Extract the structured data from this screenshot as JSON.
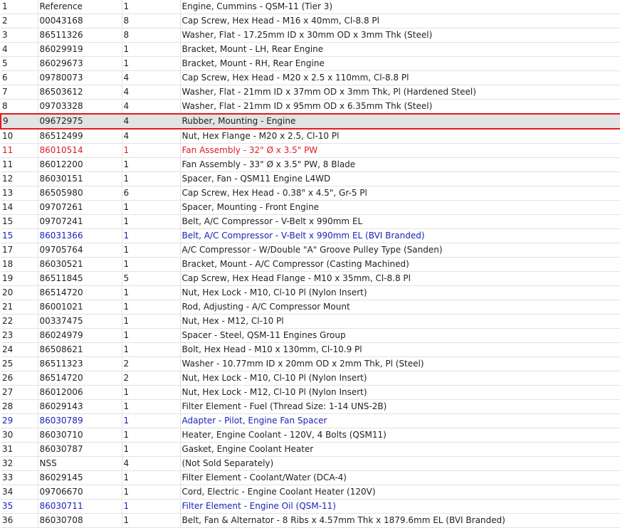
{
  "colors": {
    "selected_border": "#e11b22",
    "selected_bg": "#e3e3e3",
    "red_text": "#e11b22",
    "blue_text": "#1a23b8",
    "grid": "#e2e2e2"
  },
  "parts_table": {
    "rows": [
      {
        "num": "1",
        "part": "Reference",
        "qty": "1",
        "desc": "Engine, Cummins - QSM-11 (Tier 3)",
        "style": ""
      },
      {
        "num": "2",
        "part": "00043168",
        "qty": "8",
        "desc": "Cap Screw, Hex Head - M16 x 40mm, Cl-8.8 Pl",
        "style": ""
      },
      {
        "num": "3",
        "part": "86511326",
        "qty": "8",
        "desc": "Washer, Flat - 17.25mm ID x 30mm OD x 3mm Thk (Steel)",
        "style": ""
      },
      {
        "num": "4",
        "part": "86029919",
        "qty": "1",
        "desc": "Bracket, Mount - LH, Rear Engine",
        "style": ""
      },
      {
        "num": "5",
        "part": "86029673",
        "qty": "1",
        "desc": "Bracket, Mount - RH, Rear Engine",
        "style": ""
      },
      {
        "num": "6",
        "part": "09780073",
        "qty": "4",
        "desc": "Cap Screw, Hex Head - M20 x 2.5 x 110mm, Cl-8.8 Pl",
        "style": ""
      },
      {
        "num": "7",
        "part": "86503612",
        "qty": "4",
        "desc": "Washer, Flat - 21mm ID x 37mm OD x 3mm Thk, Pl (Hardened Steel)",
        "style": ""
      },
      {
        "num": "8",
        "part": "09703328",
        "qty": "4",
        "desc": "Washer, Flat - 21mm ID x 95mm OD x 6.35mm Thk (Steel)",
        "style": ""
      },
      {
        "num": "9",
        "part": "09672975",
        "qty": "4",
        "desc": "Rubber, Mounting - Engine",
        "style": "sel"
      },
      {
        "num": "10",
        "part": "86512499",
        "qty": "4",
        "desc": "Nut, Hex Flange - M20 x 2.5, Cl-10 Pl",
        "style": ""
      },
      {
        "num": "11",
        "part": "86010514",
        "qty": "1",
        "desc": "Fan Assembly - 32\" Ø x 3.5\" PW",
        "style": "red"
      },
      {
        "num": "11",
        "part": "86012200",
        "qty": "1",
        "desc": "Fan Assembly - 33\" Ø x 3.5\" PW, 8 Blade",
        "style": ""
      },
      {
        "num": "12",
        "part": "86030151",
        "qty": "1",
        "desc": "Spacer, Fan - QSM11 Engine L4WD",
        "style": ""
      },
      {
        "num": "13",
        "part": "86505980",
        "qty": "6",
        "desc": "Cap Screw, Hex Head - 0.38\" x 4.5\", Gr-5 Pl",
        "style": ""
      },
      {
        "num": "14",
        "part": "09707261",
        "qty": "1",
        "desc": "Spacer, Mounting - Front Engine",
        "style": ""
      },
      {
        "num": "15",
        "part": "09707241",
        "qty": "1",
        "desc": "Belt, A/C Compressor - V-Belt x 990mm EL",
        "style": ""
      },
      {
        "num": "15",
        "part": "86031366",
        "qty": "1",
        "desc": "Belt, A/C Compressor - V-Belt x 990mm EL (BVI Branded)",
        "style": "blue"
      },
      {
        "num": "17",
        "part": "09705764",
        "qty": "1",
        "desc": "A/C Compressor - W/Double \"A\" Groove Pulley Type (Sanden)",
        "style": ""
      },
      {
        "num": "18",
        "part": "86030521",
        "qty": "1",
        "desc": "Bracket, Mount - A/C Compressor (Casting Machined)",
        "style": ""
      },
      {
        "num": "19",
        "part": "86511845",
        "qty": "5",
        "desc": "Cap Screw, Hex Head Flange - M10 x 35mm, Cl-8.8 Pl",
        "style": ""
      },
      {
        "num": "20",
        "part": "86514720",
        "qty": "1",
        "desc": "Nut, Hex Lock - M10, Cl-10 Pl (Nylon Insert)",
        "style": ""
      },
      {
        "num": "21",
        "part": "86001021",
        "qty": "1",
        "desc": "Rod, Adjusting - A/C Compressor Mount",
        "style": ""
      },
      {
        "num": "22",
        "part": "00337475",
        "qty": "1",
        "desc": "Nut, Hex - M12, Cl-10 Pl",
        "style": ""
      },
      {
        "num": "23",
        "part": "86024979",
        "qty": "1",
        "desc": "Spacer - Steel, QSM-11 Engines Group",
        "style": ""
      },
      {
        "num": "24",
        "part": "86508621",
        "qty": "1",
        "desc": "Bolt, Hex Head - M10 x 130mm, Cl-10.9 Pl",
        "style": ""
      },
      {
        "num": "25",
        "part": "86511323",
        "qty": "2",
        "desc": "Washer - 10.77mm ID x 20mm OD x 2mm Thk, Pl (Steel)",
        "style": ""
      },
      {
        "num": "26",
        "part": "86514720",
        "qty": "2",
        "desc": "Nut, Hex Lock - M10, Cl-10 Pl (Nylon Insert)",
        "style": ""
      },
      {
        "num": "27",
        "part": "86012006",
        "qty": "1",
        "desc": "Nut, Hex Lock - M12, Cl-10 Pl (Nylon Insert)",
        "style": ""
      },
      {
        "num": "28",
        "part": "86029143",
        "qty": "1",
        "desc": "Filter Element - Fuel (Thread Size: 1-14 UNS-2B)",
        "style": ""
      },
      {
        "num": "29",
        "part": "86030789",
        "qty": "1",
        "desc": "Adapter - Pilot, Engine Fan Spacer",
        "style": "blue"
      },
      {
        "num": "30",
        "part": "86030710",
        "qty": "1",
        "desc": "Heater, Engine Coolant - 120V, 4 Bolts (QSM11)",
        "style": ""
      },
      {
        "num": "31",
        "part": "86030787",
        "qty": "1",
        "desc": "Gasket, Engine Coolant Heater",
        "style": ""
      },
      {
        "num": "32",
        "part": "NSS",
        "qty": "4",
        "desc": "(Not Sold Separately)",
        "style": ""
      },
      {
        "num": "33",
        "part": "86029145",
        "qty": "1",
        "desc": "Filter Element - Coolant/Water (DCA-4)",
        "style": ""
      },
      {
        "num": "34",
        "part": "09706670",
        "qty": "1",
        "desc": "Cord, Electric - Engine Coolant Heater (120V)",
        "style": ""
      },
      {
        "num": "35",
        "part": "86030711",
        "qty": "1",
        "desc": "Filter Element - Engine Oil (QSM-11)",
        "style": "blue"
      },
      {
        "num": "36",
        "part": "86030708",
        "qty": "1",
        "desc": "Belt, Fan & Alternator - 8 Ribs x 4.57mm Thk x 1879.6mm EL (BVI Branded)",
        "style": ""
      }
    ]
  }
}
